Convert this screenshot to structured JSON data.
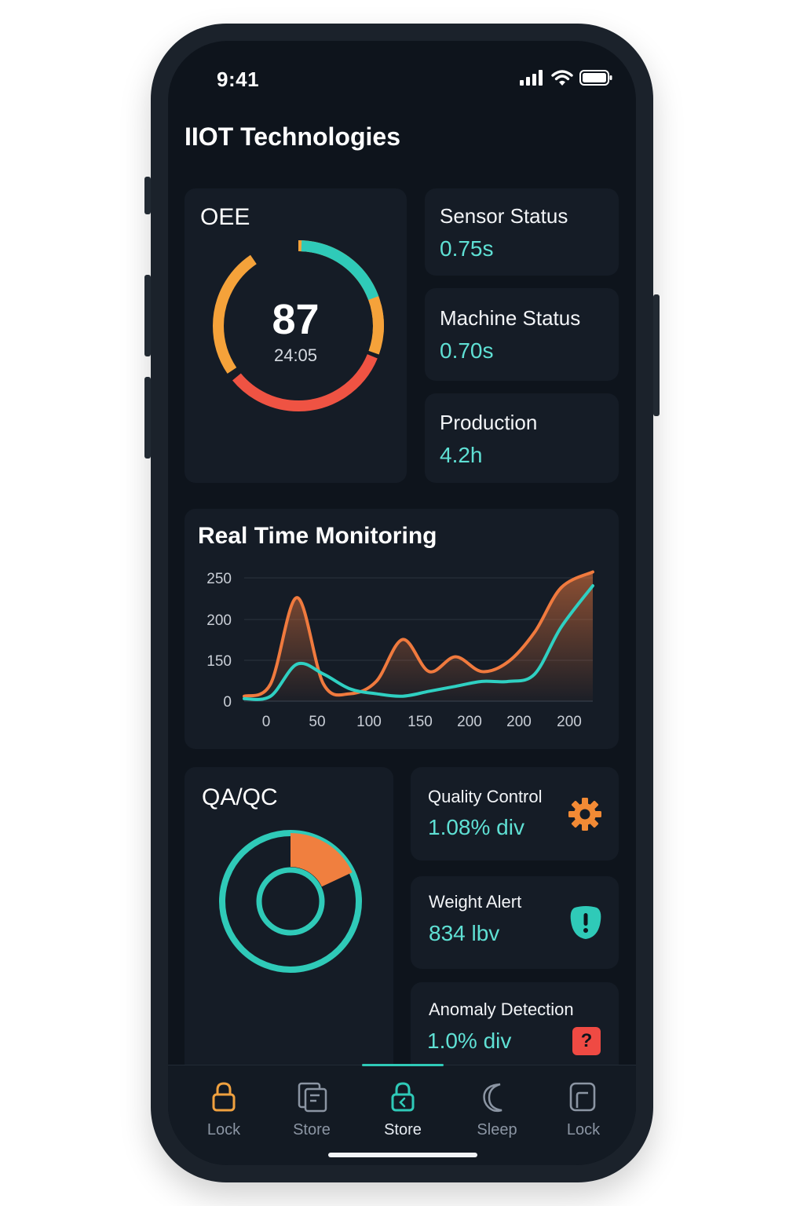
{
  "status": {
    "time": "9:41"
  },
  "app": {
    "title": "IIOT Technologies"
  },
  "oee": {
    "label": "OEE",
    "value": "87",
    "time": "24:05"
  },
  "stats": [
    {
      "label": "Sensor Status",
      "value": "0.75s"
    },
    {
      "label": "Machine Status",
      "value": "0.70s"
    },
    {
      "label": "Production",
      "value": "4.2h"
    }
  ],
  "monitoring": {
    "title": "Real Time Monitoring"
  },
  "chart_data": {
    "type": "area",
    "title": "Real Time Monitoring",
    "categories": [
      "0",
      "50",
      "100",
      "150",
      "200",
      "200",
      "200"
    ],
    "y_ticks": [
      "250",
      "200",
      "150",
      "0"
    ],
    "ylim": [
      0,
      250
    ],
    "grid": true,
    "series": [
      {
        "color": "#f07a3e",
        "x": [
          0,
          25,
          50,
          75,
          100,
          125,
          150,
          175,
          200,
          225,
          250,
          275,
          300,
          330
        ],
        "values": [
          10,
          35,
          210,
          35,
          15,
          40,
          125,
          60,
          90,
          60,
          80,
          140,
          230,
          262
        ]
      },
      {
        "color": "#2fd0c2",
        "x": [
          0,
          25,
          50,
          75,
          100,
          125,
          150,
          175,
          200,
          225,
          250,
          275,
          300,
          330
        ],
        "values": [
          5,
          10,
          75,
          55,
          25,
          15,
          10,
          20,
          30,
          40,
          40,
          55,
          150,
          234
        ]
      }
    ]
  },
  "qa": {
    "title": "QA/QC",
    "donut_fill": 0.18,
    "colors": {
      "accent": "#f07f3f",
      "ring": "#2fcab8"
    }
  },
  "alerts": [
    {
      "label": "Quality Control",
      "value": "1.08% div",
      "icon": "gear-icon"
    },
    {
      "label": "Weight Alert",
      "value": "834 lbv",
      "icon": "shield-alert-icon"
    },
    {
      "label": "Anomaly Detection",
      "value": "1.0% div",
      "icon": "question-icon",
      "badge": "?"
    }
  ],
  "nav": [
    {
      "label": "Lock",
      "icon": "lock-icon"
    },
    {
      "label": "Store",
      "icon": "store-icon"
    },
    {
      "label": "Store",
      "icon": "lock-back-icon"
    },
    {
      "label": "Sleep",
      "icon": "moon-icon"
    },
    {
      "label": "Lock",
      "icon": "page-icon"
    }
  ],
  "colors": {
    "accent_teal": "#5fe0d4",
    "accent_orange": "#f5a23a",
    "accent_red": "#ef5343",
    "bg": "#0e141c",
    "card": "#151c26"
  }
}
